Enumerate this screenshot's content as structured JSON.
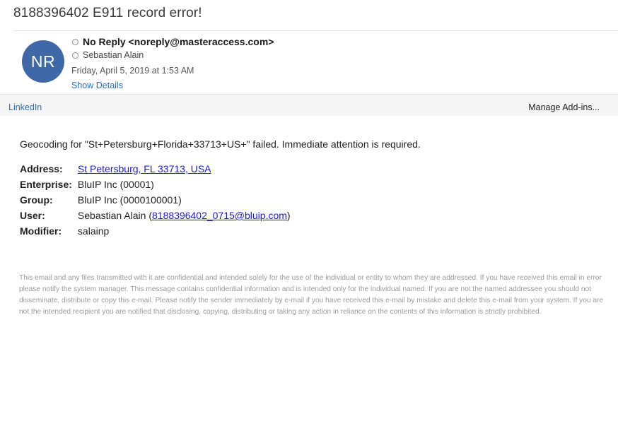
{
  "subject": "8188396402 E911 record error!",
  "header": {
    "avatar_initials": "NR",
    "avatar_color": "#3f68a8",
    "from": "No Reply <noreply@masteraccess.com>",
    "to": "Sebastian Alain",
    "date": "Friday, April 5, 2019 at 1:53 AM",
    "show_details": "Show Details"
  },
  "addin_bar": {
    "linkedin": "LinkedIn",
    "manage": "Manage Add-ins..."
  },
  "body": {
    "intro": "Geocoding for \"St+Petersburg+Florida+33713+US+\" failed. Immediate attention is required.",
    "address_label": "Address:",
    "address_value": "St Petersburg, FL 33713, USA",
    "enterprise_label": "Enterprise:",
    "enterprise_value": "BluIP Inc (00001)",
    "group_label": "Group:",
    "group_value": "BluIP Inc (0000100001)",
    "user_label": "User:",
    "user_name": "Sebastian Alain (",
    "user_email": "8188396402_0715@bluip.com",
    "user_close": ")",
    "modifier_label": "Modifier:",
    "modifier_value": "salainp"
  },
  "disclaimer": "This email and any files transmitted with it are confidential and intended solely for the use of the individual or entity to whom they are addressed. If you have received this email in error please notify the system manager. This message contains confidential information and is intended only for the individual named. If you are not the named addressee you should not disseminate, distribute or copy this e-mail. Please notify the sender immediately by e-mail if you have received this e-mail by mistake and delete this e-mail from your system. If you are not the intended recipient you are notified that disclosing, copying, distributing or taking any action in reliance on the contents of this information is strictly prohibited."
}
